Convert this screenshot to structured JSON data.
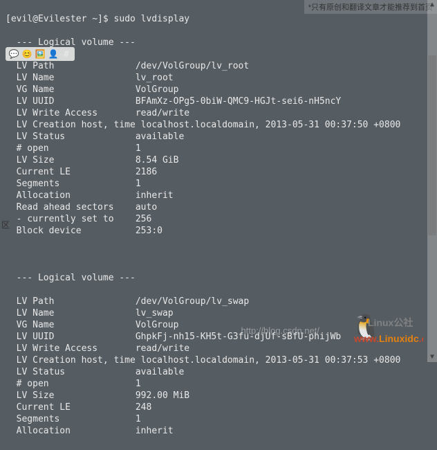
{
  "prompt": {
    "user_host": "[evil@Evilester ~]$",
    "command": "sudo lvdisplay"
  },
  "header_note": "*只有原创和翻译文章才能推荐到首页",
  "section_header": "  --- Logical volume ---",
  "volumes": [
    {
      "fields": [
        {
          "label": "  LV Path               ",
          "value": "/dev/VolGroup/lv_root"
        },
        {
          "label": "  LV Name               ",
          "value": "lv_root"
        },
        {
          "label": "  VG Name               ",
          "value": "VolGroup"
        },
        {
          "label": "  LV UUID               ",
          "value": "BFAmXz-OPg5-0biW-QMC9-HGJt-sei6-nH5ncY"
        },
        {
          "label": "  LV Write Access       ",
          "value": "read/write"
        },
        {
          "label": "  LV Creation host, time",
          "value": " localhost.localdomain, 2013-05-31 00:37:50 +0800"
        },
        {
          "label": "  LV Status             ",
          "value": "available"
        },
        {
          "label": "  # open                ",
          "value": "1"
        },
        {
          "label": "  LV Size               ",
          "value": "8.54 GiB"
        },
        {
          "label": "  Current LE            ",
          "value": "2186"
        },
        {
          "label": "  Segments              ",
          "value": "1"
        },
        {
          "label": "  Allocation            ",
          "value": "inherit"
        },
        {
          "label": "  Read ahead sectors    ",
          "value": "auto"
        },
        {
          "label": "  - currently set to    ",
          "value": "256"
        },
        {
          "label": "  Block device          ",
          "value": "253:0"
        }
      ]
    },
    {
      "fields": [
        {
          "label": "  LV Path               ",
          "value": "/dev/VolGroup/lv_swap"
        },
        {
          "label": "  LV Name               ",
          "value": "lv_swap"
        },
        {
          "label": "  VG Name               ",
          "value": "VolGroup"
        },
        {
          "label": "  LV UUID               ",
          "value": "GhpkFj-nh15-KH5t-G3fu-djUf-sBfU-phijWb"
        },
        {
          "label": "  LV Write Access       ",
          "value": "read/write"
        },
        {
          "label": "  LV Creation host, time",
          "value": " localhost.localdomain, 2013-05-31 00:37:53 +0800"
        },
        {
          "label": "  LV Status             ",
          "value": "available"
        },
        {
          "label": "  # open                ",
          "value": "1"
        },
        {
          "label": "  LV Size               ",
          "value": "992.00 MiB"
        },
        {
          "label": "  Current LE            ",
          "value": "248"
        },
        {
          "label": "  Segments              ",
          "value": "1"
        },
        {
          "label": "  Allocation            ",
          "value": "inherit"
        }
      ]
    }
  ],
  "watermark": {
    "blog_url": "http://blog.csdn.net/",
    "site_cn": "Linux公社",
    "site_url_www": "www.",
    "site_url_domain": "Linuxidc",
    "site_url_tld": ".com"
  },
  "close_glyph": "区"
}
